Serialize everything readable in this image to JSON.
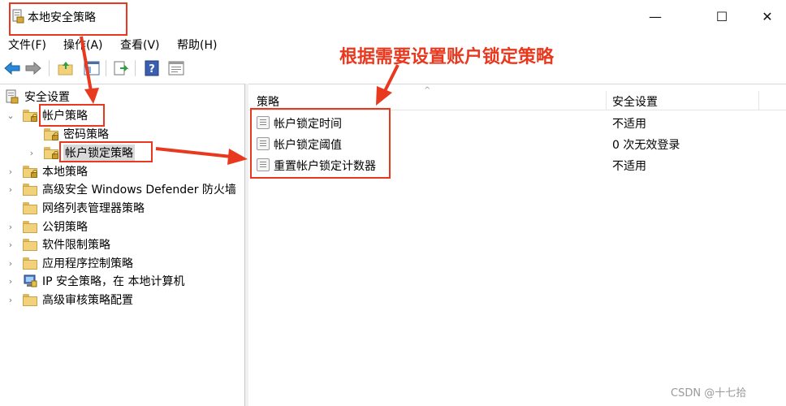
{
  "window": {
    "title": "本地安全策略",
    "minimize_glyph": "—",
    "maximize_glyph": "☐",
    "close_glyph": "✕"
  },
  "menu": [
    "文件(F)",
    "操作(A)",
    "查看(V)",
    "帮助(H)"
  ],
  "toolbar": {
    "icons": [
      "back-arrow-icon",
      "forward-arrow-icon",
      "up-folder-icon",
      "show-hide-tree-icon",
      "export-list-icon",
      "help-icon",
      "properties-icon"
    ]
  },
  "tree": {
    "root": "安全设置",
    "items": [
      {
        "label": "帐户策略"
      },
      {
        "label": "密码策略"
      },
      {
        "label": "帐户锁定策略"
      },
      {
        "label": "本地策略"
      },
      {
        "label": "高级安全 Windows Defender 防火墙"
      },
      {
        "label": "网络列表管理器策略"
      },
      {
        "label": "公钥策略"
      },
      {
        "label": "软件限制策略"
      },
      {
        "label": "应用程序控制策略"
      },
      {
        "label": "IP 安全策略，在 本地计算机"
      },
      {
        "label": "高级审核策略配置"
      }
    ]
  },
  "list": {
    "columns": [
      "策略",
      "安全设置"
    ],
    "rows": [
      {
        "name": "帐户锁定时间",
        "value": "不适用"
      },
      {
        "name": "帐户锁定阈值",
        "value": "0 次无效登录"
      },
      {
        "name": "重置帐户锁定计数器",
        "value": "不适用"
      }
    ]
  },
  "annotation": {
    "text": "根据需要设置账户锁定策略",
    "color": "#e8391f"
  },
  "watermark": "CSDN @十七拾"
}
